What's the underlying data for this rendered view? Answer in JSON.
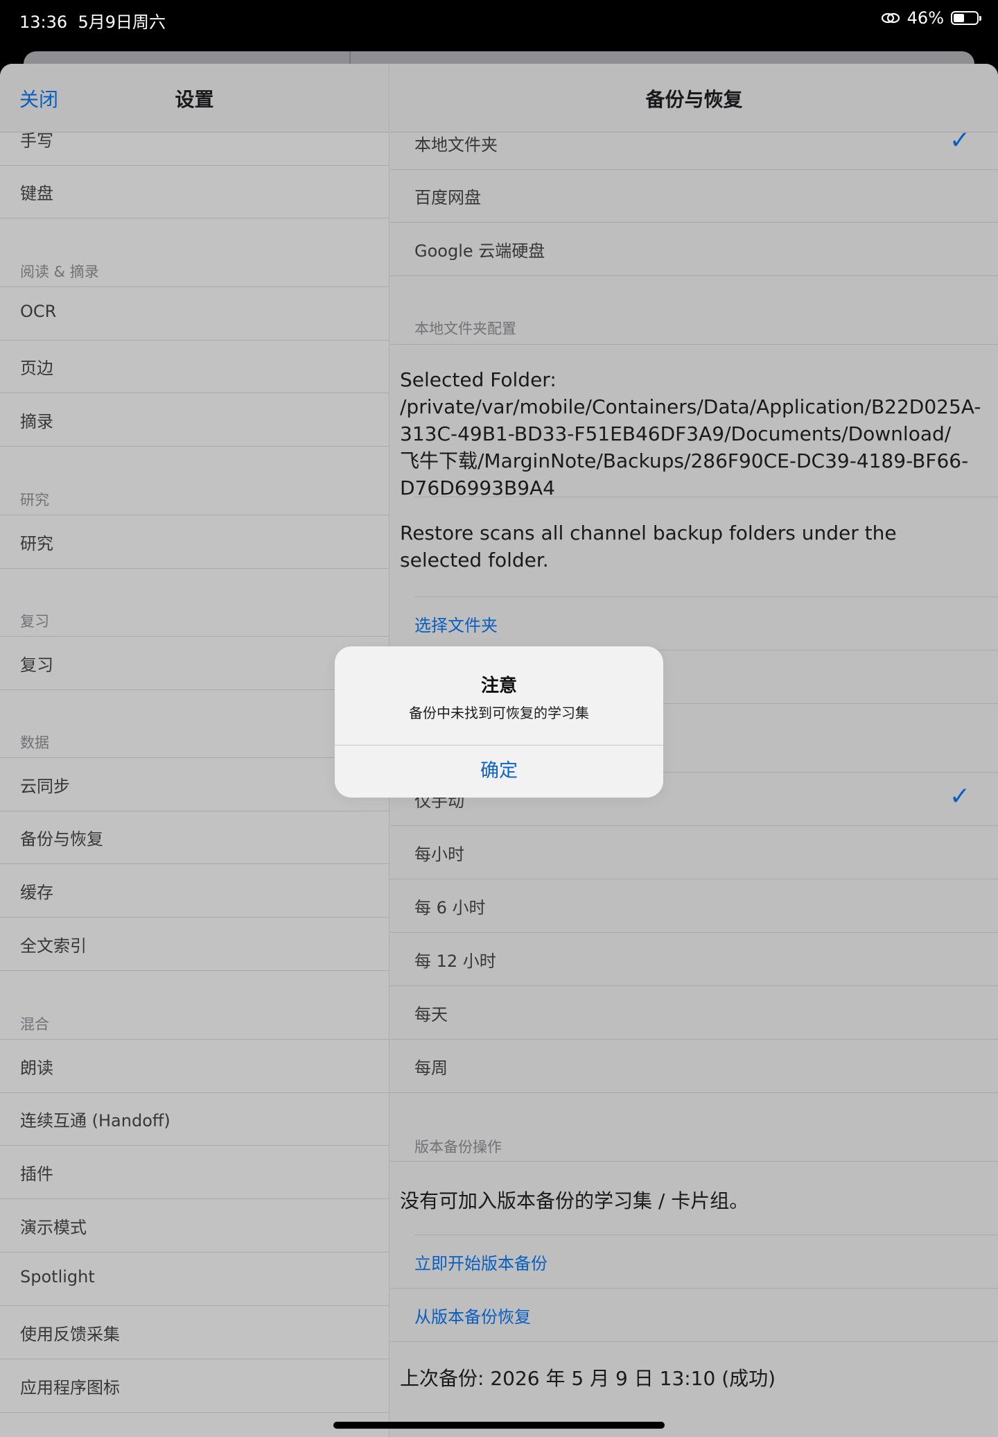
{
  "status_bar": {
    "time": "13:36",
    "date": "5月9日周六",
    "battery_percent": "46%",
    "battery_level": 0.46
  },
  "sidebar": {
    "title": "设置",
    "close_label": "关闭",
    "items": [
      {
        "type": "row",
        "label": "手写"
      },
      {
        "type": "row",
        "label": "键盘"
      },
      {
        "type": "header",
        "label": "阅读 & 摘录"
      },
      {
        "type": "row",
        "label": "OCR"
      },
      {
        "type": "row",
        "label": "页边"
      },
      {
        "type": "row",
        "label": "摘录"
      },
      {
        "type": "header",
        "label": "研究"
      },
      {
        "type": "row",
        "label": "研究"
      },
      {
        "type": "header",
        "label": "复习"
      },
      {
        "type": "row",
        "label": "复习"
      },
      {
        "type": "header",
        "label": "数据"
      },
      {
        "type": "row",
        "label": "云同步"
      },
      {
        "type": "row",
        "label": "备份与恢复"
      },
      {
        "type": "row",
        "label": "缓存"
      },
      {
        "type": "row",
        "label": "全文索引"
      },
      {
        "type": "header",
        "label": "混合"
      },
      {
        "type": "row",
        "label": "朗读"
      },
      {
        "type": "row",
        "label": "连续互通 (Handoff)"
      },
      {
        "type": "row",
        "label": "插件"
      },
      {
        "type": "row",
        "label": "演示模式"
      },
      {
        "type": "row",
        "label": "Spotlight"
      },
      {
        "type": "row",
        "label": "使用反馈采集"
      },
      {
        "type": "row",
        "label": "应用程序图标"
      }
    ]
  },
  "detail": {
    "title": "备份与恢复",
    "channels": [
      {
        "label": "本地文件夹",
        "checked": true
      },
      {
        "label": "百度网盘",
        "checked": false
      },
      {
        "label": "Google 云端硬盘",
        "checked": false
      }
    ],
    "local_config_header": "本地文件夹配置",
    "selected_folder_text": "Selected Folder: /private/var/mobile/Containers/Data/Application/B22D025A-313C-49B1-BD33-F51EB46DF3A9/Documents/Download/飞牛下载/MarginNote/Backups/286F90CE-DC39-4189-BF66-D76D6993B9A4",
    "restore_note": "Restore scans all channel backup folders under the selected folder.",
    "choose_folder": "选择文件夹",
    "frequency": [
      {
        "label": "仅手动",
        "checked": true
      },
      {
        "label": "每小时",
        "checked": false
      },
      {
        "label": "每 6 小时",
        "checked": false
      },
      {
        "label": "每 12 小时",
        "checked": false
      },
      {
        "label": "每天",
        "checked": false
      },
      {
        "label": "每周",
        "checked": false
      }
    ],
    "version_header": "版本备份操作",
    "no_items_text": "没有可加入版本备份的学习集 / 卡片组。",
    "start_backup": "立即开始版本备份",
    "restore_from_version": "从版本备份恢复",
    "last_backup": "上次备份: 2026 年 5 月 9 日 13:10 (成功)"
  },
  "alert": {
    "title": "注意",
    "message": "备份中未找到可恢复的学习集",
    "ok": "确定"
  }
}
